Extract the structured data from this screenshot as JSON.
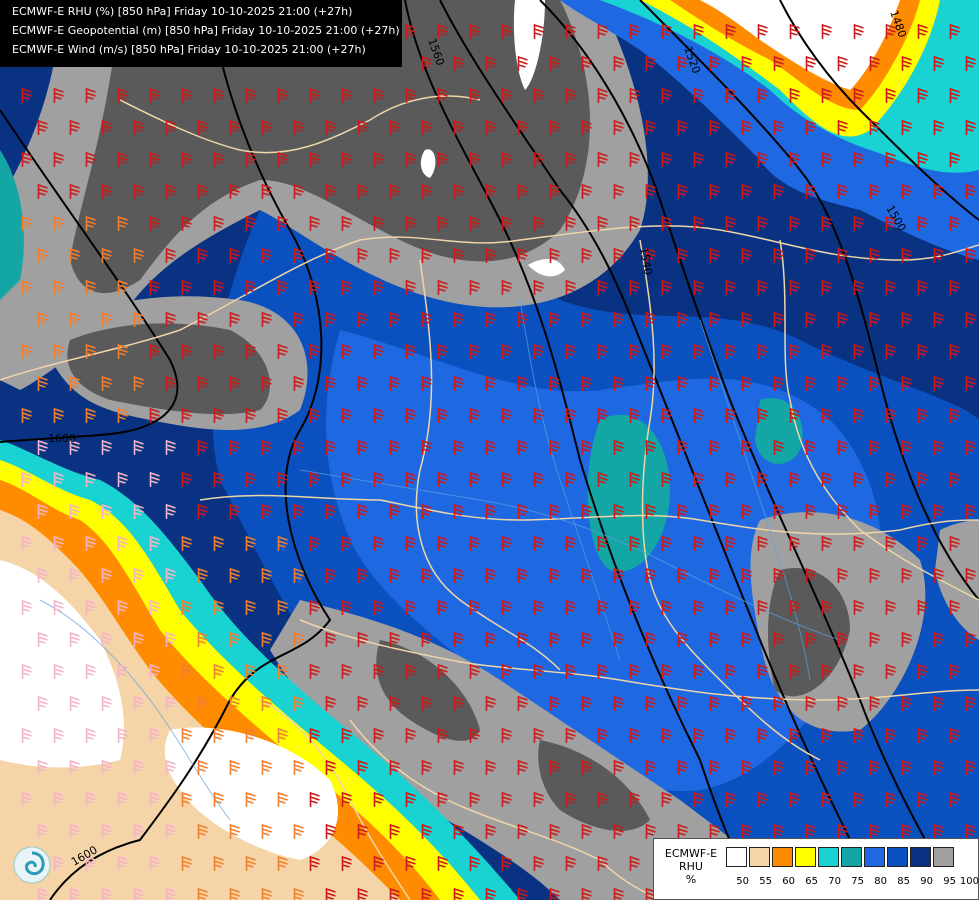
{
  "header": {
    "line1": "ECMWF-E RHU (%) [850 hPa] Friday 10-10-2025 21:00 (+27h)",
    "line2": "ECMWF-E Geopotential (m) [850 hPa] Friday 10-10-2025 21:00 (+27h)",
    "line3": "ECMWF-E Wind (m/s) [850 hPa] Friday 10-10-2025 21:00 (+27h)"
  },
  "contours": [
    {
      "label": "1560"
    },
    {
      "label": "1520"
    },
    {
      "label": "1480"
    },
    {
      "label": "1540"
    },
    {
      "label": "1500"
    },
    {
      "label": "1580"
    },
    {
      "label": "1600"
    }
  ],
  "legend": {
    "title_line1": "ECMWF-E",
    "title_line2": "RHU",
    "title_line3": "%",
    "levels": [
      "50",
      "55",
      "60",
      "65",
      "70",
      "75",
      "80",
      "85",
      "90",
      "95",
      "100"
    ],
    "colors": [
      "#ffffff",
      "#f5d5a8",
      "#ff8c00",
      "#ffff00",
      "#19d2d2",
      "#14a5a5",
      "#1e69e1",
      "#0a50be",
      "#0a3282",
      "#a0a0a0",
      "#5a5a5a"
    ]
  },
  "logo": {
    "icon": "ecmwf-swirl-icon"
  }
}
